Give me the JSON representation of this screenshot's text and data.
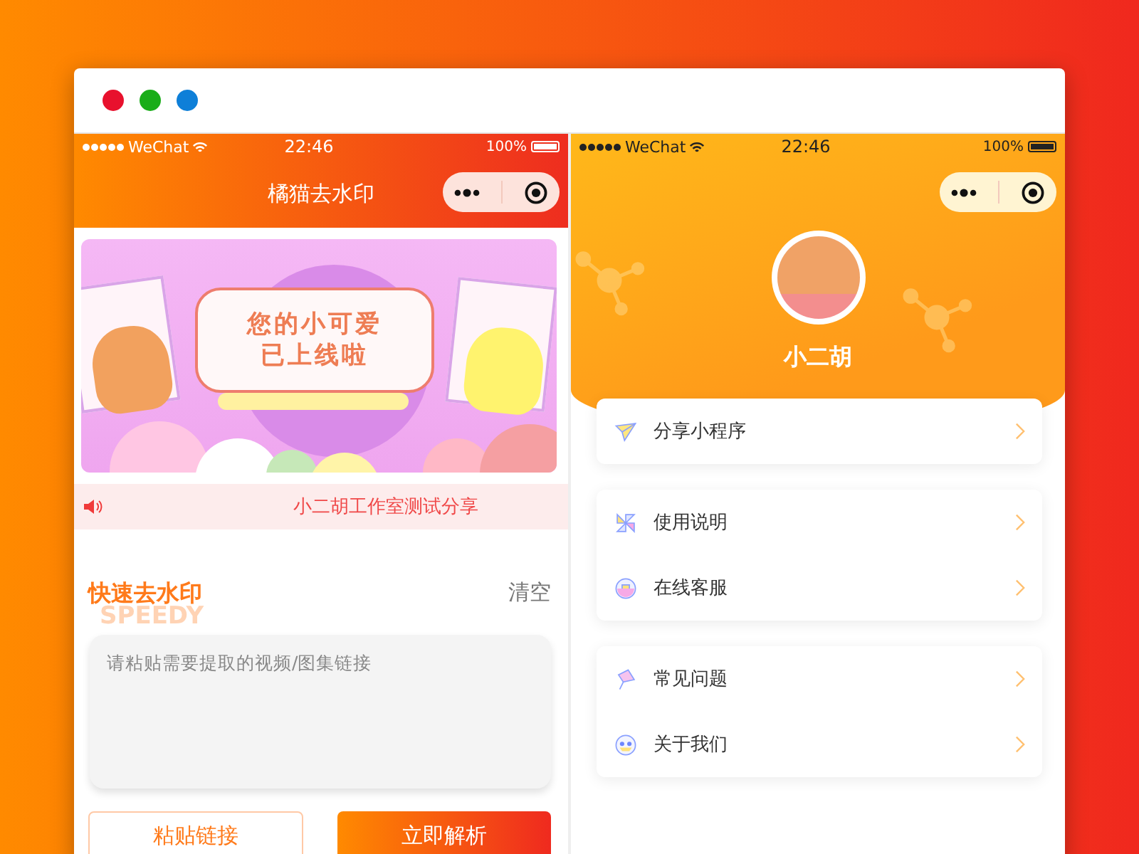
{
  "left_phone": {
    "status_bar": {
      "carrier": "WeChat",
      "time": "22:46",
      "battery": "100%"
    },
    "nav_title": "橘猫去水印",
    "banner": {
      "headline": [
        "您的小可爱",
        "已上线啦"
      ]
    },
    "notice": {
      "text": "小二胡工作室测试分享"
    },
    "section": {
      "title": "快速去水印",
      "watermark": "SPEEDY",
      "clear": "清空"
    },
    "input": {
      "placeholder": "请粘贴需要提取的视频/图集链接"
    },
    "buttons": [
      {
        "label": "粘贴链接",
        "kind": "outline"
      },
      {
        "label": "立即解析",
        "kind": "primary"
      }
    ]
  },
  "right_phone": {
    "status_bar": {
      "carrier": "WeChat",
      "time": "22:46",
      "battery": "100%"
    },
    "profile": {
      "name": "小二胡"
    },
    "menu_groups": [
      {
        "items": [
          {
            "label": "分享小程序"
          }
        ]
      },
      {
        "items": [
          {
            "label": "使用说明"
          },
          {
            "label": "在线客服"
          }
        ]
      },
      {
        "items": [
          {
            "label": "常见问题"
          },
          {
            "label": "关于我们"
          }
        ]
      }
    ]
  }
}
